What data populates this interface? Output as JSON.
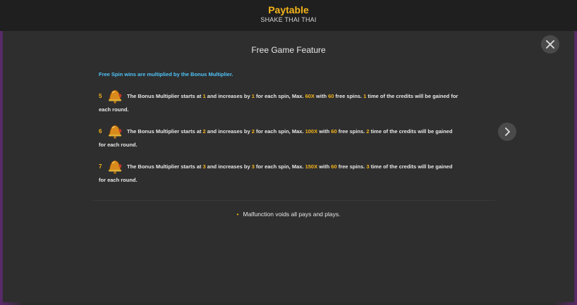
{
  "header": {
    "title": "Paytable",
    "subtitle": "SHAKE THAI THAI"
  },
  "page": {
    "section_title": "Free Game Feature",
    "intro": "Free Spin wins are multiplied by the Bonus Multiplier.",
    "rows": [
      {
        "count": "5",
        "pre1": "The Bonus Multiplier starts at ",
        "start": "1",
        "pre2": " and increases by ",
        "step": "1",
        "pre3": " for each spin, Max. ",
        "max": "60X",
        "pre4": " with ",
        "spins": "60",
        "pre5": " free spins. ",
        "times": "1",
        "pre6": " time of the credits will be gained for",
        "line2": "each round."
      },
      {
        "count": "6",
        "pre1": "The Bonus Multiplier starts at ",
        "start": "2",
        "pre2": " and increases by ",
        "step": "2",
        "pre3": " for each spin, Max. ",
        "max": "100X",
        "pre4": " with ",
        "spins": "60",
        "pre5": " free spins. ",
        "times": "2",
        "pre6": " time of the credits will be gained",
        "line2": "for each round."
      },
      {
        "count": "7",
        "pre1": "The Bonus Multiplier starts at ",
        "start": "3",
        "pre2": " and increases by ",
        "step": "3",
        "pre3": " for each spin, Max. ",
        "max": "150X",
        "pre4": " with ",
        "spins": "60",
        "pre5": " free spins. ",
        "times": "3",
        "pre6": " time of the credits will be gained",
        "line2": "for each round."
      }
    ],
    "note": "Malfunction voids all pays and plays."
  },
  "icons": {
    "close": "close-icon",
    "next": "chevron-right-icon",
    "symbol": "bell-icon"
  },
  "colors": {
    "accent": "#f5b51b",
    "intro": "#4fc3f7"
  }
}
